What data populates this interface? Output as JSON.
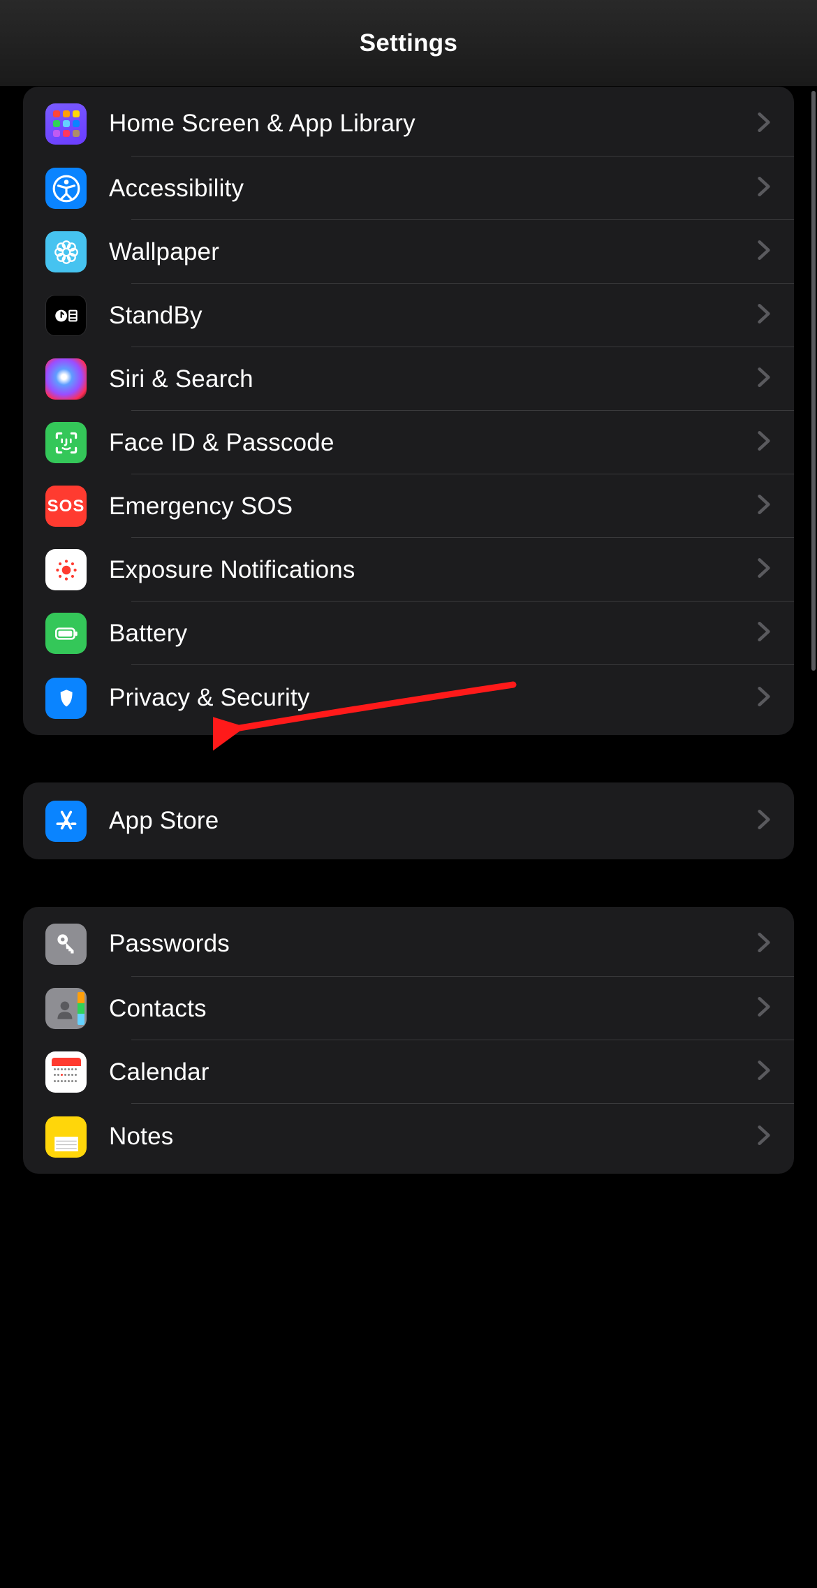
{
  "header": {
    "title": "Settings"
  },
  "groups": [
    {
      "items": [
        {
          "key": "home",
          "label": "Home Screen & App Library",
          "icon": "home-screen-icon"
        },
        {
          "key": "access",
          "label": "Accessibility",
          "icon": "accessibility-icon"
        },
        {
          "key": "wall",
          "label": "Wallpaper",
          "icon": "wallpaper-icon"
        },
        {
          "key": "standby",
          "label": "StandBy",
          "icon": "standby-icon"
        },
        {
          "key": "siri",
          "label": "Siri & Search",
          "icon": "siri-icon"
        },
        {
          "key": "faceid",
          "label": "Face ID & Passcode",
          "icon": "faceid-icon"
        },
        {
          "key": "sos",
          "label": "Emergency SOS",
          "icon": "sos-icon",
          "icon_text": "SOS"
        },
        {
          "key": "expo",
          "label": "Exposure Notifications",
          "icon": "exposure-icon"
        },
        {
          "key": "batt",
          "label": "Battery",
          "icon": "battery-icon"
        },
        {
          "key": "priv",
          "label": "Privacy & Security",
          "icon": "privacy-icon"
        }
      ]
    },
    {
      "items": [
        {
          "key": "app",
          "label": "App Store",
          "icon": "appstore-icon"
        }
      ]
    },
    {
      "items": [
        {
          "key": "pass",
          "label": "Passwords",
          "icon": "passwords-icon"
        },
        {
          "key": "cont",
          "label": "Contacts",
          "icon": "contacts-icon"
        },
        {
          "key": "cal",
          "label": "Calendar",
          "icon": "calendar-icon"
        },
        {
          "key": "notes",
          "label": "Notes",
          "icon": "notes-icon"
        }
      ]
    }
  ],
  "annotation": {
    "target": "batt",
    "type": "arrow",
    "color": "#ff1a1a"
  }
}
